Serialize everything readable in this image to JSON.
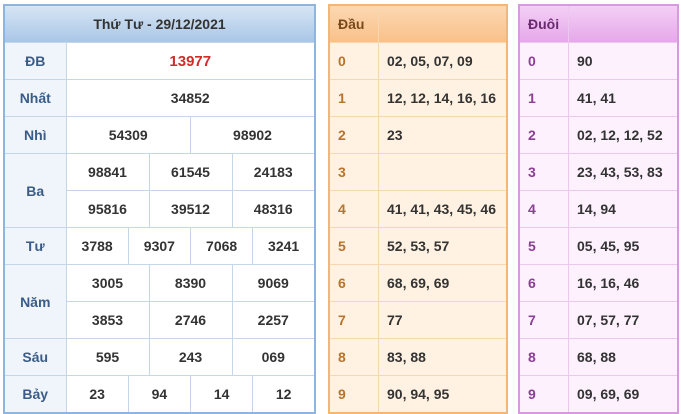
{
  "results": {
    "title": "Thứ Tư - 29/12/2021",
    "rows": {
      "db": {
        "label": "ĐB",
        "values": [
          "13977"
        ]
      },
      "nhat": {
        "label": "Nhất",
        "values": [
          "34852"
        ]
      },
      "nhi": {
        "label": "Nhì",
        "values": [
          "54309",
          "98902"
        ]
      },
      "ba": {
        "label": "Ba",
        "values": [
          "98841",
          "61545",
          "24183",
          "95816",
          "39512",
          "48316"
        ]
      },
      "tu": {
        "label": "Tư",
        "values": [
          "3788",
          "9307",
          "7068",
          "3241"
        ]
      },
      "nam": {
        "label": "Năm",
        "values": [
          "3005",
          "8390",
          "9069",
          "3853",
          "2746",
          "2257"
        ]
      },
      "sau": {
        "label": "Sáu",
        "values": [
          "595",
          "243",
          "069"
        ]
      },
      "bay": {
        "label": "Bảy",
        "values": [
          "23",
          "94",
          "14",
          "12"
        ]
      }
    }
  },
  "head_table": {
    "title": "Đầu",
    "rows": [
      {
        "digit": "0",
        "nums": "02, 05, 07, 09"
      },
      {
        "digit": "1",
        "nums": "12, 12, 14, 16, 16"
      },
      {
        "digit": "2",
        "nums": "23"
      },
      {
        "digit": "3",
        "nums": ""
      },
      {
        "digit": "4",
        "nums": "41, 41, 43, 45, 46"
      },
      {
        "digit": "5",
        "nums": "52, 53, 57"
      },
      {
        "digit": "6",
        "nums": "68, 69, 69"
      },
      {
        "digit": "7",
        "nums": "77"
      },
      {
        "digit": "8",
        "nums": "83, 88"
      },
      {
        "digit": "9",
        "nums": "90, 94, 95"
      }
    ]
  },
  "tail_table": {
    "title": "Đuôi",
    "rows": [
      {
        "digit": "0",
        "nums": "90"
      },
      {
        "digit": "1",
        "nums": "41, 41"
      },
      {
        "digit": "2",
        "nums": "02, 12, 12, 52"
      },
      {
        "digit": "3",
        "nums": "23, 43, 53, 83"
      },
      {
        "digit": "4",
        "nums": "14, 94"
      },
      {
        "digit": "5",
        "nums": "05, 45, 95"
      },
      {
        "digit": "6",
        "nums": "16, 16, 46"
      },
      {
        "digit": "7",
        "nums": "07, 57, 77"
      },
      {
        "digit": "8",
        "nums": "68, 88"
      },
      {
        "digit": "9",
        "nums": "09, 69, 69"
      }
    ]
  },
  "colors": {
    "special_prize": "#d22b2b",
    "results_border": "#8fb5dc",
    "head_border": "#f0b779",
    "tail_border": "#d89adf"
  }
}
